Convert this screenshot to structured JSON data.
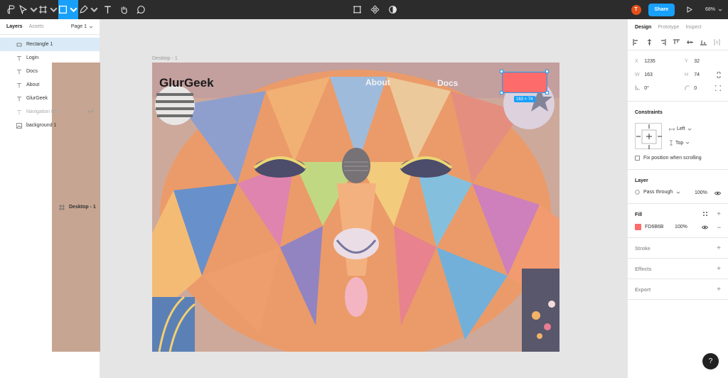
{
  "colors": {
    "toolbar_bg": "#2c2c2c",
    "accent": "#18a0fb",
    "fill": "#fd6b6b",
    "avatar": "#e2501b"
  },
  "toolbar": {
    "icons": [
      "figma-menu-icon",
      "move-tool-icon",
      "frame-tool-icon",
      "rectangle-tool-icon",
      "pen-tool-icon",
      "text-tool-icon",
      "hand-tool-icon",
      "comment-tool-icon"
    ],
    "center_icons": [
      "component-icon",
      "mask-icon",
      "contrast-icon"
    ],
    "avatar_letter": "T",
    "share_label": "Share",
    "zoom_label": "68%"
  },
  "left_panel": {
    "tab_layers": "Layers",
    "tab_assets": "Assets",
    "page_label": "Page 1",
    "frame_name": "Desktop - 1",
    "layers": [
      {
        "name": "Rectangle 1",
        "icon": "rectangle-layer-icon",
        "selected": true
      },
      {
        "name": "Login",
        "icon": "text-layer-icon"
      },
      {
        "name": "Docs",
        "icon": "text-layer-icon"
      },
      {
        "name": "About",
        "icon": "text-layer-icon"
      },
      {
        "name": "GlurGeek",
        "icon": "text-layer-icon"
      },
      {
        "name": "Navigation Bar",
        "icon": "text-layer-icon",
        "hidden": true
      },
      {
        "name": "background 1",
        "icon": "image-layer-icon"
      }
    ]
  },
  "canvas": {
    "frame_label": "Desktop - 1",
    "logo": "GlurGeek",
    "nav_about": "About",
    "nav_docs": "Docs",
    "size_badge": "163 × 74"
  },
  "right_panel": {
    "tab_design": "Design",
    "tab_prototype": "Prototype",
    "tab_inspect": "Inspect",
    "x_label": "X",
    "x_value": "1235",
    "y_label": "Y",
    "y_value": "32",
    "w_label": "W",
    "w_value": "163",
    "h_label": "H",
    "h_value": "74",
    "rotation": "0°",
    "radius": "0",
    "constraints_title": "Constraints",
    "constraint_h": "Left",
    "constraint_v": "Top",
    "fix_position": "Fix position when scrolling",
    "layer_title": "Layer",
    "blend_mode": "Pass through",
    "layer_opacity": "100%",
    "fill_title": "Fill",
    "fill_hex": "FD6B6B",
    "fill_opacity": "100%",
    "stroke_title": "Stroke",
    "effects_title": "Effects",
    "export_title": "Export"
  },
  "help_label": "?"
}
